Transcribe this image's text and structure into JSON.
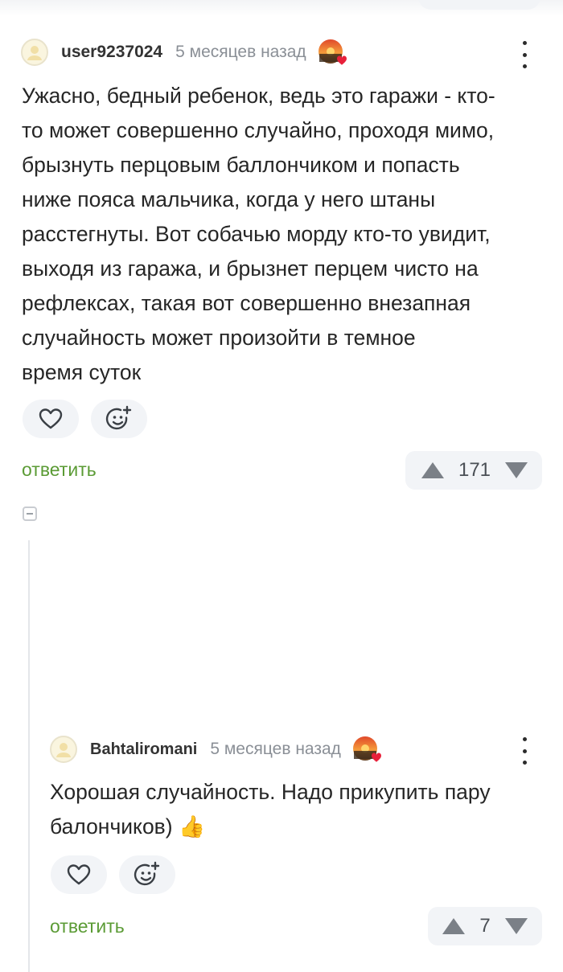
{
  "comment": {
    "username": "user9237024",
    "timestamp": "5 месяцев назад",
    "avatar_icon": "user-avatar-icon",
    "badge_icon": "sunset-heart-badge-icon",
    "text": "Ужасно, бедный ребенок, ведь это гаражи - кто-\nто может совершенно случайно, проходя мимо,\nбрызнуть перцовым баллончиком и попасть\nниже пояса мальчика, когда у него штаны\nрасстегнуты. Вот собачью морду кто-то увидит,\nвыходя из гаража, и брызнет перцем чисто на\nрефлексах, такая вот совершенно внезапная\nслучайность может произойти в темное\nвремя суток",
    "reply_label": "ответить",
    "rating": "171"
  },
  "reply": {
    "username": "Bahtaliromani",
    "timestamp": "5 месяцев назад",
    "avatar_icon": "user-avatar-icon",
    "badge_icon": "sunset-heart-badge-icon",
    "text": "Хорошая случайность. Надо прикупить пару\nбалончиков) 👍",
    "reply_label": "ответить",
    "rating": "7"
  },
  "colors": {
    "reply_link": "#5b9b35",
    "pill_background": "#f2f4f7",
    "text": "#262626",
    "meta": "#8a8f96"
  }
}
